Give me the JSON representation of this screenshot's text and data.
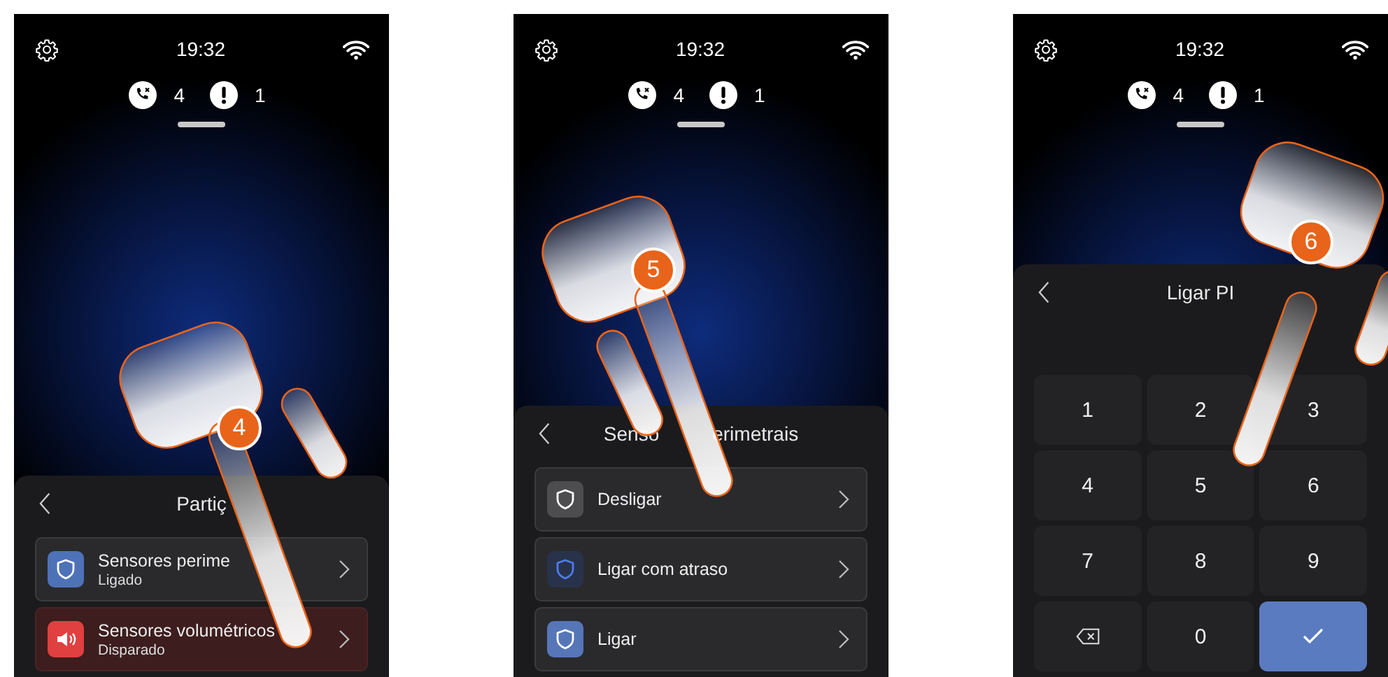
{
  "phones": [
    {
      "status": {
        "time": "19:32",
        "missed_calls": "4",
        "alerts": "1"
      },
      "step": "4",
      "sheet": {
        "kind": "list",
        "title": [
          "Partiç"
        ],
        "rows": [
          {
            "title": "Sensores perime",
            "subtitle": "Ligado",
            "kind": "shield",
            "color": "#4e72b8",
            "alarm": false
          },
          {
            "title": "Sensores volumétricos",
            "subtitle": "Disparado",
            "kind": "speaker",
            "color": "#e0403f",
            "alarm": true
          }
        ]
      }
    },
    {
      "status": {
        "time": "19:32",
        "missed_calls": "4",
        "alerts": "1"
      },
      "step": "5",
      "sheet": {
        "kind": "list",
        "title": [
          "Senso",
          "erimetrais"
        ],
        "rows": [
          {
            "title": "Desligar",
            "kind": "shield",
            "color": "#4d4d4f",
            "alarm": false
          },
          {
            "title": "Ligar com atraso",
            "kind": "shield-accent",
            "color": "#28324a",
            "alarm": false
          },
          {
            "title": "Ligar",
            "kind": "shield",
            "color": "#5676b8",
            "alarm": false
          }
        ]
      }
    },
    {
      "status": {
        "time": "19:32",
        "missed_calls": "4",
        "alerts": "1"
      },
      "step": "6",
      "sheet": {
        "kind": "keypad",
        "title": [
          "Ligar PI"
        ],
        "keys": [
          {
            "kind": "digit",
            "label": "1"
          },
          {
            "kind": "digit",
            "label": "2"
          },
          {
            "kind": "digit",
            "label": "3"
          },
          {
            "kind": "digit",
            "label": "4"
          },
          {
            "kind": "digit",
            "label": "5"
          },
          {
            "kind": "digit",
            "label": "6"
          },
          {
            "kind": "digit",
            "label": "7"
          },
          {
            "kind": "digit",
            "label": "8"
          },
          {
            "kind": "digit",
            "label": "9"
          },
          {
            "kind": "backspace"
          },
          {
            "kind": "digit",
            "label": "0"
          },
          {
            "kind": "confirm"
          }
        ]
      }
    }
  ]
}
